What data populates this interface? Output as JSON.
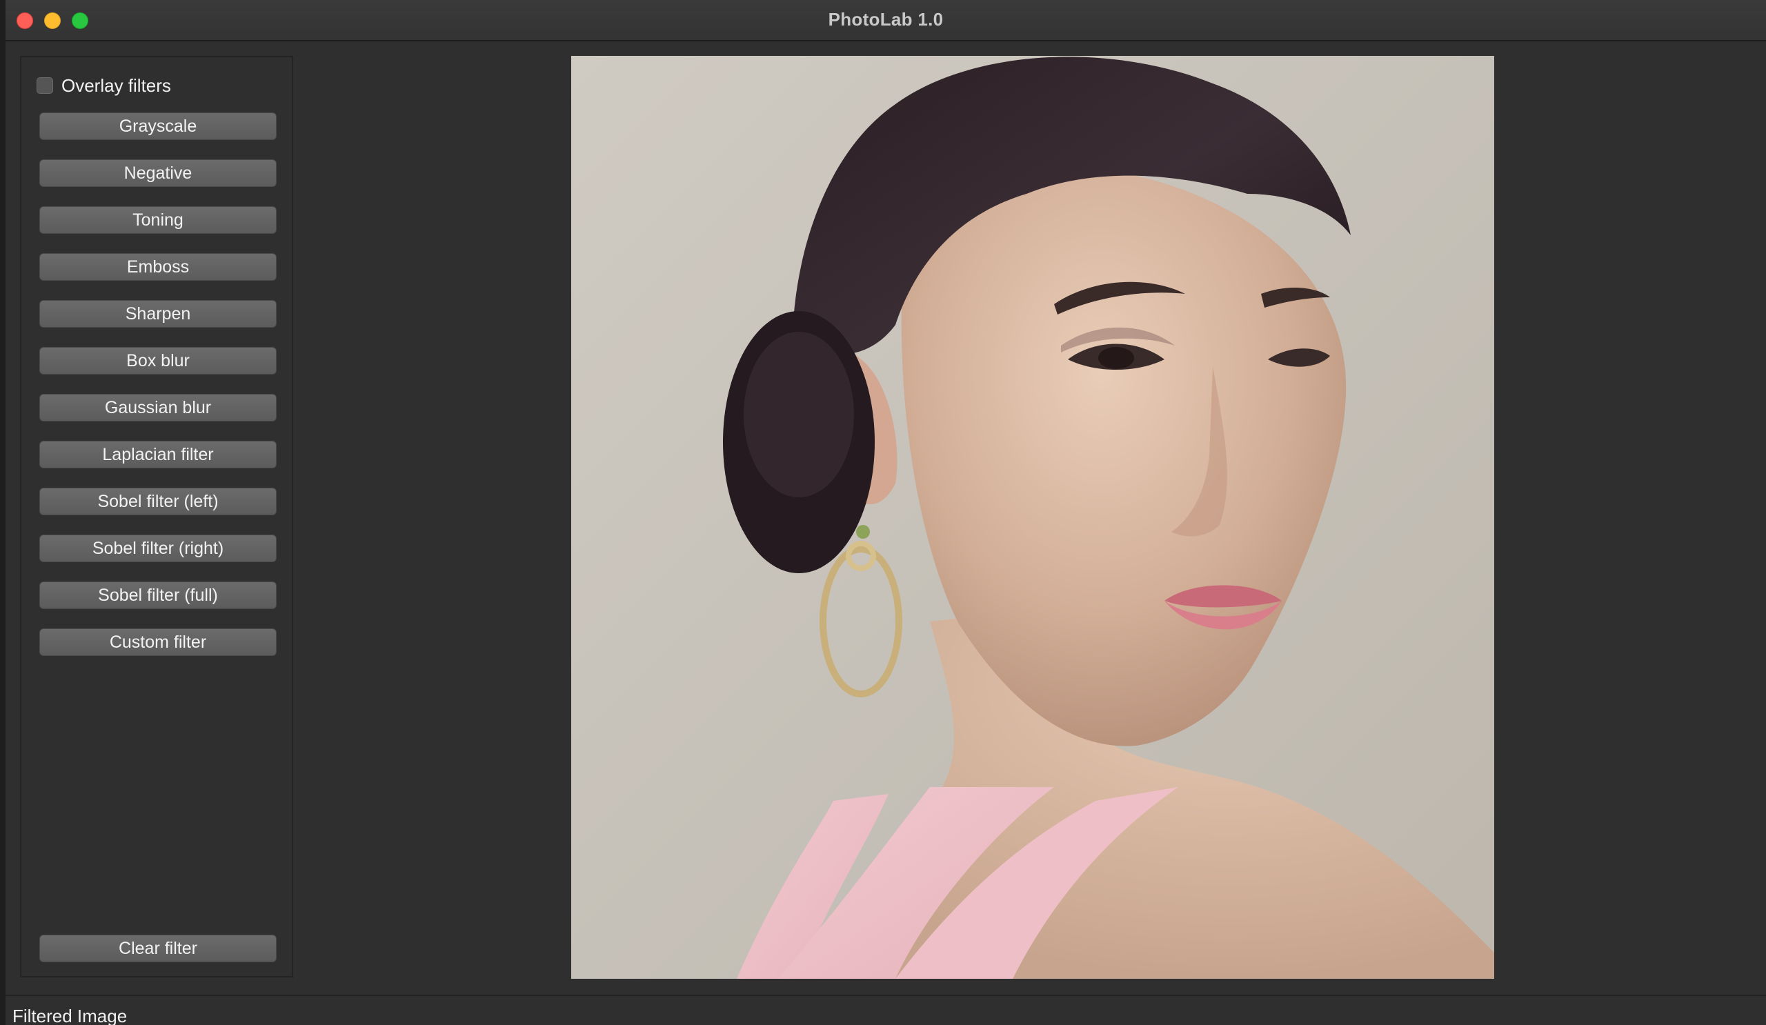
{
  "window": {
    "title": "PhotoLab 1.0"
  },
  "sidebar": {
    "overlay_label": "Overlay filters",
    "overlay_checked": false,
    "filters": [
      "Grayscale",
      "Negative",
      "Toning",
      "Emboss",
      "Sharpen",
      "Box blur",
      "Gaussian blur",
      "Laplacian filter",
      "Sobel filter (left)",
      "Sobel filter (right)",
      "Sobel filter (full)",
      "Custom filter"
    ],
    "clear_label": "Clear filter"
  },
  "image": {
    "icon": "portrait-photo"
  },
  "status": {
    "text": "Filtered Image"
  },
  "colors": {
    "window_bg": "#2f2f2f",
    "button_bg": "#646464",
    "close": "#ff5f57",
    "minimize": "#febc2e",
    "zoom": "#28c840"
  }
}
